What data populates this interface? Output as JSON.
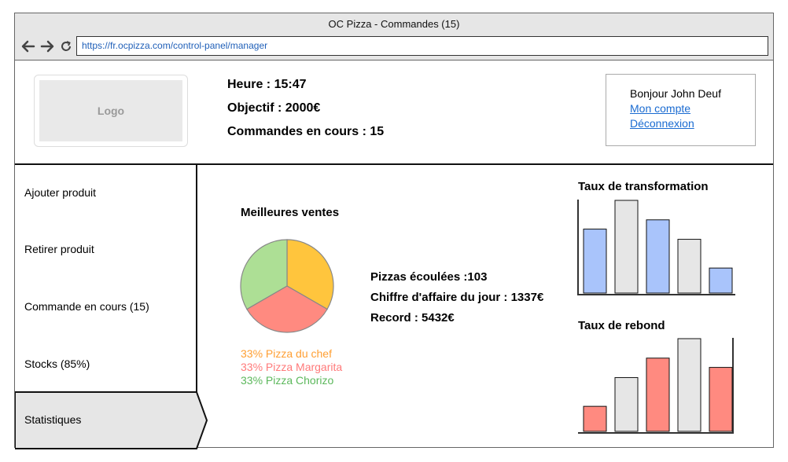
{
  "window": {
    "title": "OC Pizza - Commandes (15)",
    "url": "https://fr.ocpizza.com/control-panel/manager",
    "nav_icons": [
      "back-arrow-icon",
      "forward-arrow-icon",
      "reload-icon"
    ]
  },
  "header": {
    "logo_label": "Logo",
    "heure": "Heure : 15:47",
    "objectif": "Objectif : 2000€",
    "commandes": "Commandes en cours : 15",
    "user": {
      "greeting": "Bonjour John Deuf",
      "account_link": "Mon compte",
      "logout_link": "Déconnexion"
    }
  },
  "sidebar": {
    "items": [
      {
        "label": "Ajouter produit"
      },
      {
        "label": "Retirer produit"
      },
      {
        "label": "Commande en cours (15)"
      },
      {
        "label": "Stocks (85%)"
      },
      {
        "label": "Statistiques",
        "active": true
      }
    ]
  },
  "main": {
    "best_sales_title": "Meilleures ventes",
    "legend": [
      {
        "label": "33% Pizza du chef",
        "color": "#ff9f33"
      },
      {
        "label": "33% Pizza Margarita",
        "color": "#ff7a7a"
      },
      {
        "label": "33% Pizza Chorizo",
        "color": "#5cb85c"
      }
    ],
    "pizzas_ecoulees": "Pizzas écoulées :103",
    "chiffre_affaire": "Chiffre d'affaire du jour : 1337€",
    "record": "Record : 5432€",
    "transformation_title": "Taux de transformation",
    "rebond_title": "Taux de rebond"
  },
  "chart_data": [
    {
      "type": "pie",
      "title": "Meilleures ventes",
      "categories": [
        "Pizza du chef",
        "Pizza Margarita",
        "Pizza Chorizo"
      ],
      "values": [
        33,
        33,
        33
      ],
      "colors": [
        "#ffc53d",
        "#ff8a80",
        "#addf95"
      ]
    },
    {
      "type": "bar",
      "title": "Taux de transformation",
      "values": [
        0.69,
        1.0,
        0.79,
        0.58,
        0.27
      ],
      "colors": [
        "#a9c4fb",
        "#e6e6e6",
        "#a9c4fb",
        "#e6e6e6",
        "#a9c4fb"
      ],
      "xlabel": "",
      "ylabel": ""
    },
    {
      "type": "bar",
      "title": "Taux de rebond",
      "values": [
        0.27,
        0.58,
        0.79,
        1.0,
        0.69
      ],
      "colors": [
        "#ff8a80",
        "#e6e6e6",
        "#ff8a80",
        "#e6e6e6",
        "#ff8a80"
      ],
      "xlabel": "",
      "ylabel": ""
    }
  ]
}
